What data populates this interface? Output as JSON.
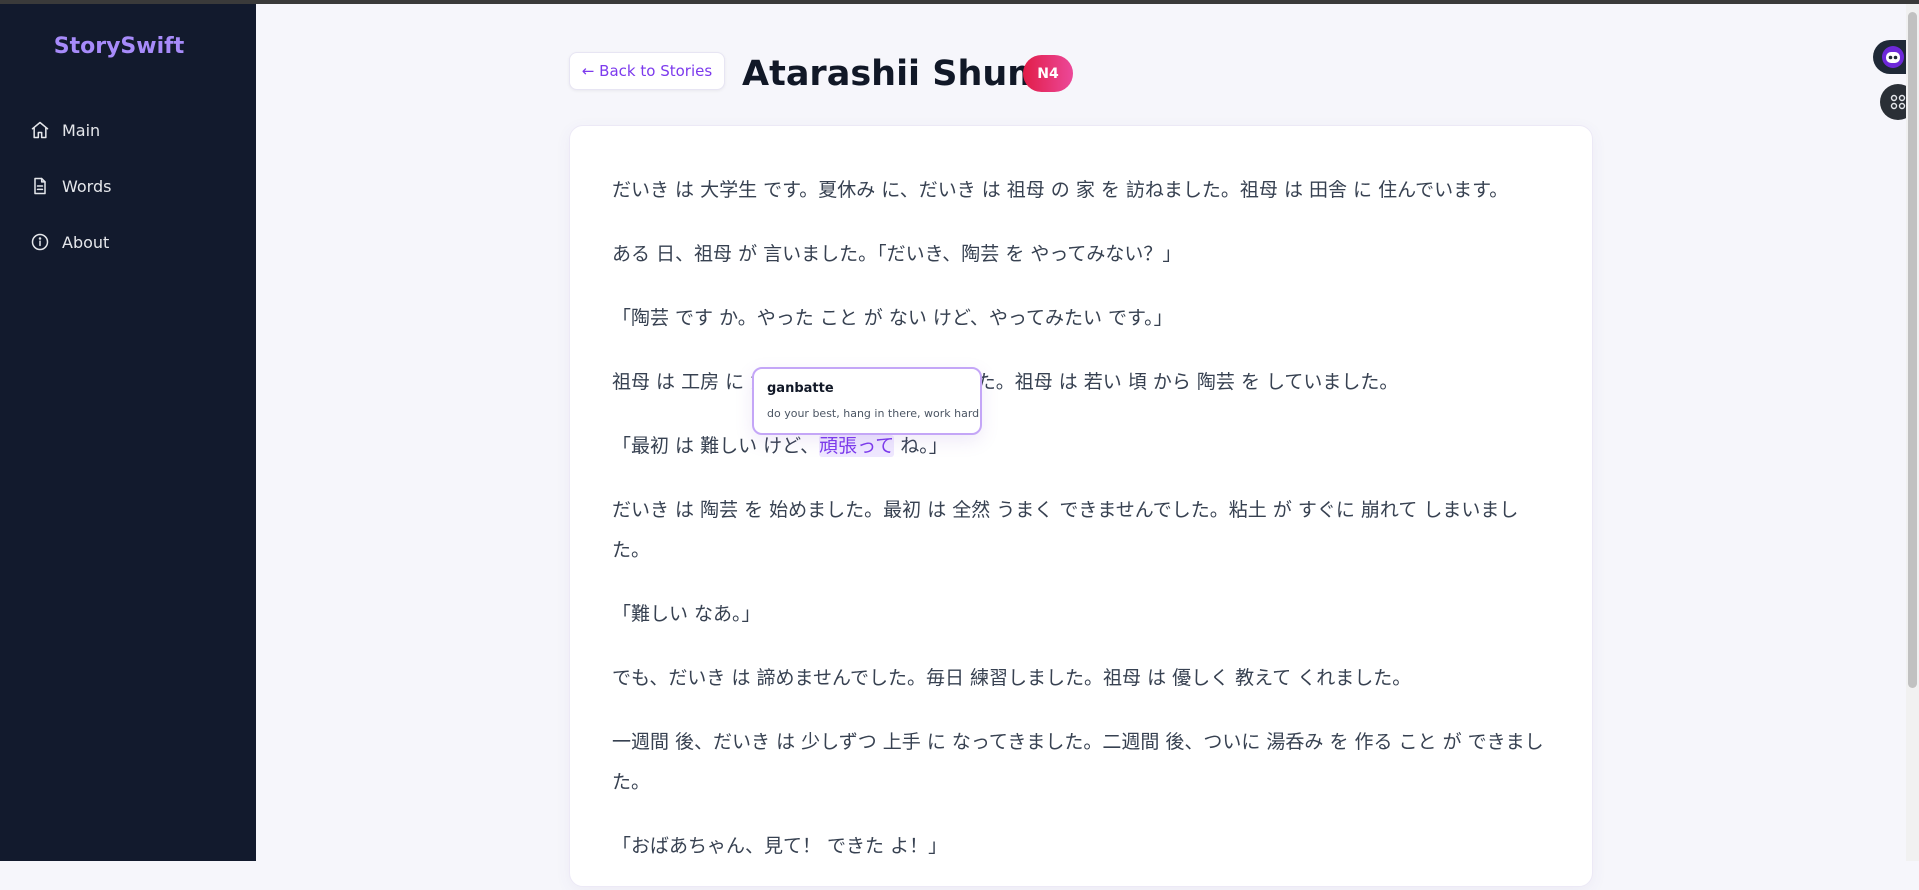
{
  "app": {
    "brand": "StorySwift"
  },
  "sidebar": {
    "items": [
      {
        "label": "Main",
        "icon": "home-icon"
      },
      {
        "label": "Words",
        "icon": "document-icon"
      },
      {
        "label": "About",
        "icon": "info-icon"
      }
    ]
  },
  "header": {
    "back_label": "← Back to Stories",
    "title": "Atarashii Shumi",
    "level": "N4"
  },
  "story": {
    "paragraphs": [
      "だいき は 大学生 です。夏休み に、だいき は 祖母 の 家 を 訪ねました。祖母 は 田舎 に 住んでいます。",
      "ある 日、祖母 が 言いました。「だいき、陶芸 を やってみない？」",
      "「陶芸 です か。やった こと が ない けど、やってみたい です。」",
      "祖母 は 工房 に だいき を 連れて 行きました。祖母 は 若い 頃 から 陶芸 を していました。",
      {
        "before": "「最初 は 難しい けど、",
        "highlight": "頑張って",
        "after": " ね。」"
      },
      "だいき は 陶芸 を 始めました。最初 は 全然 うまく できませんでした。粘土 が すぐに 崩れて しまいました。",
      "「難しい なあ。」",
      "でも、だいき は 諦めませんでした。毎日 練習しました。祖母 は 優しく 教えて くれました。",
      "一週間 後、だいき は 少しずつ 上手 に なってきました。二週間 後、ついに 湯呑み を 作る こと が できました。",
      "「おばあちゃん、見て！ できた よ！」"
    ]
  },
  "tooltip": {
    "romaji": "ganbatte",
    "meaning": "do your best, hang in there, work hard"
  },
  "colors": {
    "sidebar_bg": "#121a2d",
    "brand": "#a78bfa",
    "accent": "#7c3aed",
    "badge_start": "#e11d48",
    "badge_end": "#ec4899"
  },
  "floating": {
    "assistant_icon": "assistant-face-icon",
    "apps_icon": "apps-grid-icon"
  }
}
